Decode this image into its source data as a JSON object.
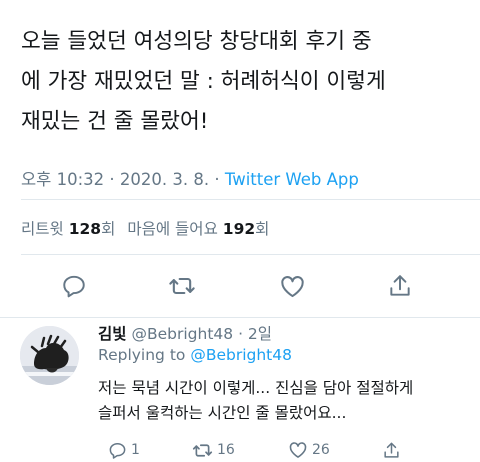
{
  "tweet": {
    "text_lines": [
      "오늘 들었던 여성의당 창당대회 후기 중",
      "에 가장 재밌었던 말 : 허례허식이 이렇게",
      "재밌는 건 줄 몰랐어!"
    ],
    "time": "오후 10:32",
    "separator": "·",
    "date": "2020. 3. 8.",
    "app": "Twitter Web App",
    "stats": {
      "retweets_label": "리트윗",
      "retweets_count": "128",
      "retweets_suffix": "회",
      "likes_label": "마음에 들어요",
      "likes_count": "192",
      "likes_suffix": "회"
    },
    "actions": {
      "reply_icon": "reply-icon",
      "retweet_icon": "retweet-icon",
      "like_icon": "heart-icon",
      "share_icon": "share-icon"
    }
  },
  "reply": {
    "name": "김빛",
    "handle": "@Bebright48",
    "time_ago": "· 2일",
    "replying_prefix": "Replying to",
    "replying_handle": "@Bebright48",
    "text_lines": [
      "저는 묵념 시간이 이렇게... 진심을 담아 절절하게",
      "슬퍼서 울컥하는 시간인 줄 몰랐어요..."
    ],
    "counts": {
      "replies": "1",
      "retweets": "16",
      "likes": "26"
    }
  },
  "colors": {
    "text": "#14171a",
    "muted": "#657786",
    "accent": "#1da1f2",
    "divider": "#e1e8ed"
  }
}
